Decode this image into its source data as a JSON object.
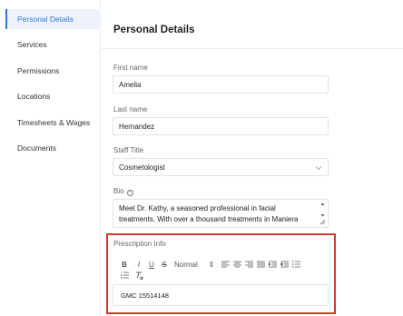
{
  "sidebar": {
    "items": [
      {
        "label": "Personal Details",
        "active": true
      },
      {
        "label": "Services"
      },
      {
        "label": "Permissions"
      },
      {
        "label": "Locations"
      },
      {
        "label": "Timesheets & Wages"
      },
      {
        "label": "Documents"
      }
    ]
  },
  "main": {
    "title": "Personal Details",
    "first_name": {
      "label": "First name",
      "value": "Amelia"
    },
    "last_name": {
      "label": "Last name",
      "value": "Hernandez"
    },
    "staff_title": {
      "label": "Staff Title",
      "value": "Cosmetologist"
    },
    "bio": {
      "label": "Bio",
      "value": "Meet Dr. Kathy, a seasoned professional in facial treatments. With over a thousand treatments in Maniera Medical alone"
    },
    "prescription": {
      "label": "Prescription Info",
      "toolbar": {
        "bold": "B",
        "italic": "I",
        "underline": "U",
        "strike": "S",
        "format": "Normal",
        "format_arrows": "⇕"
      },
      "value": "GMC 15514148"
    }
  },
  "colors": {
    "accent": "#2f7bd8",
    "highlight_border": "#d23b2c",
    "active_bg": "#eef3fb"
  }
}
